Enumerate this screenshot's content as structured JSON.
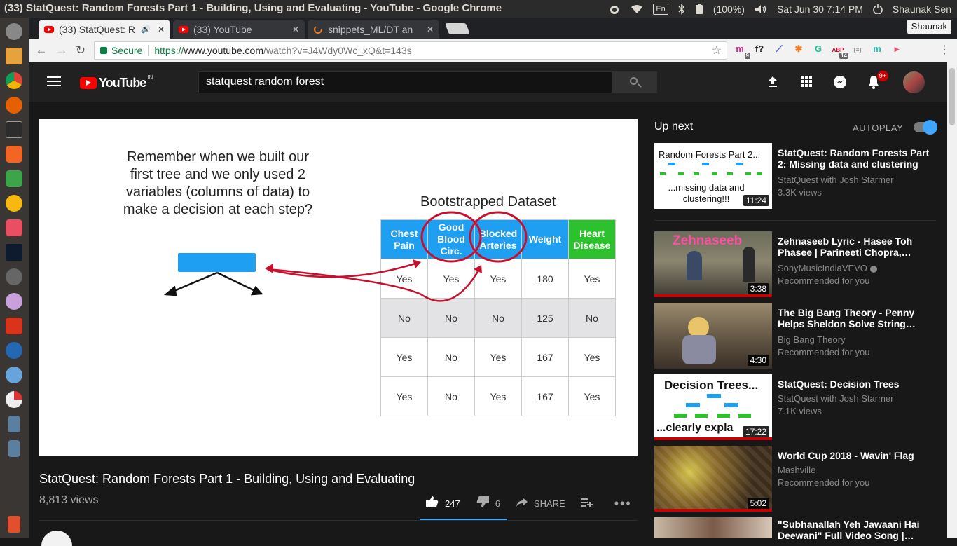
{
  "os": {
    "window_title": "(33) StatQuest: Random Forests Part 1 - Building, Using and Evaluating - YouTube - Google Chrome",
    "lang": "En",
    "battery": "(100%)",
    "datetime": "Sat Jun 30  7:14 PM",
    "user": "Shaunak Sen"
  },
  "chrome": {
    "tabs": [
      {
        "label": "(33) StatQuest: R",
        "active": true
      },
      {
        "label": "(33) YouTube",
        "active": false
      },
      {
        "label": "snippets_ML/DT an",
        "active": false
      }
    ],
    "profile": "Shaunak",
    "secure_label": "Secure",
    "url_scheme": "https://",
    "url_host": "www.youtube.com",
    "url_path": "/watch?v=J4Wdy0Wc_xQ&t=143s",
    "extensions": [
      {
        "name": "m-extension-icon",
        "glyph": "m",
        "color": "#e0218a",
        "badge": "9"
      },
      {
        "name": "formula-extension-icon",
        "glyph": "f?",
        "color": "#222",
        "badge": ""
      },
      {
        "name": "devtools-extension-icon",
        "glyph": "⟋",
        "color": "#3b5bdb",
        "badge": ""
      },
      {
        "name": "orange-extension-icon",
        "glyph": "✱",
        "color": "#f47c20",
        "badge": ""
      },
      {
        "name": "grammarly-extension-icon",
        "glyph": "G",
        "color": "#15c39a",
        "badge": ""
      },
      {
        "name": "adblock-extension-icon",
        "glyph": "ABP",
        "color": "#c70d2c",
        "badge": "14"
      },
      {
        "name": "json-extension-icon",
        "glyph": "{≡}",
        "color": "#444",
        "badge": ""
      },
      {
        "name": "mercury-extension-icon",
        "glyph": "m",
        "color": "#20c5b5",
        "badge": ""
      },
      {
        "name": "pushbullet-extension-icon",
        "glyph": "▸",
        "color": "#e9546b",
        "badge": ""
      }
    ]
  },
  "youtube": {
    "logo": "YouTube",
    "country": "IN",
    "search_value": "statquest random forest",
    "notif_count": "9+"
  },
  "slide": {
    "question": "Remember when we built our first tree and we only used 2 variables (columns of data) to make a decision at each step?",
    "title": "Bootstrapped Dataset",
    "headers": [
      "Chest Pain",
      "Good Blood Circ.",
      "Blocked Arteries",
      "Weight",
      "Heart Disease"
    ],
    "rows": [
      [
        "Yes",
        "Yes",
        "Yes",
        "180",
        "Yes"
      ],
      [
        "No",
        "No",
        "No",
        "125",
        "No"
      ],
      [
        "Yes",
        "No",
        "Yes",
        "167",
        "Yes"
      ],
      [
        "Yes",
        "No",
        "Yes",
        "167",
        "Yes"
      ]
    ],
    "colors": {
      "header_blue": "#1e9ff2",
      "header_green": "#2ec12e",
      "circle_red": "#c8102e"
    }
  },
  "video": {
    "title": "StatQuest: Random Forests Part 1 - Building, Using and Evaluating",
    "views": "8,813 views",
    "likes": "247",
    "dislikes": "6",
    "share": "SHARE"
  },
  "sidebar": {
    "upnext": "Up next",
    "autoplay": "AUTOPLAY",
    "items": [
      {
        "title": "StatQuest: Random Forests Part 2: Missing data and clustering",
        "channel": "StatQuest with Josh Starmer",
        "meta": "3.3K views",
        "duration": "11:24",
        "thumb_top": "Random Forests Part 2...",
        "thumb_bottom": "...missing data and clustering!!!",
        "watched": 0
      },
      {
        "title": "Zehnaseeb Lyric - Hasee Toh Phasee | Parineeti Chopra, Sidharth Malhotra",
        "channel": "SonyMusicIndiaVEVO",
        "meta": "Recommended for you",
        "duration": "3:38",
        "thumb_top": "Zehnaseeb",
        "thumb_bottom": "",
        "watched": 1
      },
      {
        "title": "The Big Bang Theory - Penny Helps Sheldon Solve String Theory",
        "channel": "Big Bang Theory",
        "meta": "Recommended for you",
        "duration": "4:30",
        "thumb_top": "",
        "thumb_bottom": "",
        "watched": 0
      },
      {
        "title": "StatQuest: Decision Trees",
        "channel": "StatQuest with Josh Starmer",
        "meta": "7.1K views",
        "duration": "17:22",
        "thumb_top": "Decision Trees...",
        "thumb_bottom": "...clearly expla",
        "watched": 1
      },
      {
        "title": "World Cup 2018 - Wavin' Flag",
        "channel": "Mashville",
        "meta": "Recommended for you",
        "duration": "5:02",
        "thumb_top": "",
        "thumb_bottom": "",
        "watched": 1
      },
      {
        "title": "\"Subhanallah Yeh Jawaani Hai Deewani\" Full Video Song | Ranbir Kapoor, Deepika Padukone",
        "channel": "",
        "meta": "",
        "duration": "",
        "thumb_top": "",
        "thumb_bottom": "",
        "watched": 0
      }
    ]
  }
}
